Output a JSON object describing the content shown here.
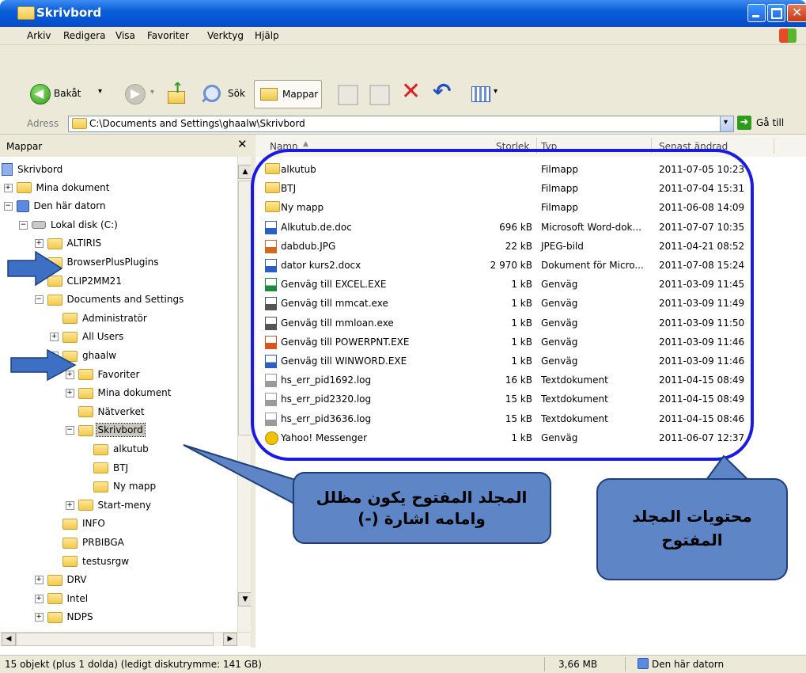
{
  "window": {
    "title": "Skrivbord"
  },
  "menu": [
    "Arkiv",
    "Redigera",
    "Visa",
    "Favoriter",
    "Verktyg",
    "Hjälp"
  ],
  "toolbar": {
    "back_label": "Bakåt",
    "search_label": "Sök",
    "folders_label": "Mappar"
  },
  "address": {
    "label": "Adress",
    "path": "C:\\Documents and Settings\\ghaalw\\Skrivbord",
    "go_label": "Gå till"
  },
  "tree": {
    "header": "Mappar",
    "nodes": [
      {
        "label": "Skrivbord",
        "indent": 0,
        "icon": "desktop-icon",
        "expander": ""
      },
      {
        "label": "Mina dokument",
        "indent": 1,
        "icon": "documents-icon",
        "expander": "+"
      },
      {
        "label": "Den här datorn",
        "indent": 1,
        "icon": "computer-icon",
        "expander": "-"
      },
      {
        "label": "Lokal disk (C:)",
        "indent": 2,
        "icon": "drive-icon",
        "expander": "-"
      },
      {
        "label": "ALTIRIS",
        "indent": 3,
        "icon": "folder-icon",
        "expander": "+"
      },
      {
        "label": "BrowserPlusPlugins",
        "indent": 3,
        "icon": "folder-icon",
        "expander": "+"
      },
      {
        "label": "CLIP2MM21",
        "indent": 3,
        "icon": "folder-icon",
        "expander": ""
      },
      {
        "label": "Documents and Settings",
        "indent": 3,
        "icon": "folder-icon",
        "expander": "-"
      },
      {
        "label": "Administratör",
        "indent": 4,
        "icon": "folder-icon",
        "expander": ""
      },
      {
        "label": "All Users",
        "indent": 4,
        "icon": "folder-icon",
        "expander": "+"
      },
      {
        "label": "ghaalw",
        "indent": 4,
        "icon": "folder-icon",
        "expander": "-"
      },
      {
        "label": "Favoriter",
        "indent": 5,
        "icon": "folder-icon",
        "expander": "+"
      },
      {
        "label": "Mina dokument",
        "indent": 5,
        "icon": "folder-icon",
        "expander": "+"
      },
      {
        "label": "Nätverket",
        "indent": 5,
        "icon": "folder-icon",
        "expander": ""
      },
      {
        "label": "Skrivbord",
        "indent": 5,
        "icon": "folder-icon",
        "expander": "-",
        "selected": true
      },
      {
        "label": "alkutub",
        "indent": 6,
        "icon": "folder-icon",
        "expander": ""
      },
      {
        "label": "BTJ",
        "indent": 6,
        "icon": "folder-icon",
        "expander": ""
      },
      {
        "label": "Ny mapp",
        "indent": 6,
        "icon": "folder-icon",
        "expander": ""
      },
      {
        "label": "Start-meny",
        "indent": 5,
        "icon": "folder-icon",
        "expander": "+"
      },
      {
        "label": "INFO",
        "indent": 4,
        "icon": "folder-icon",
        "expander": ""
      },
      {
        "label": "PRBIBGA",
        "indent": 4,
        "icon": "folder-icon",
        "expander": ""
      },
      {
        "label": "testusrgw",
        "indent": 4,
        "icon": "folder-icon",
        "expander": ""
      },
      {
        "label": "DRV",
        "indent": 3,
        "icon": "folder-icon",
        "expander": "+"
      },
      {
        "label": "Intel",
        "indent": 3,
        "icon": "folder-icon",
        "expander": "+"
      },
      {
        "label": "NDPS",
        "indent": 3,
        "icon": "folder-icon",
        "expander": "+"
      }
    ]
  },
  "list": {
    "columns": [
      "Namn",
      "Storlek",
      "Typ",
      "Senast ändrad"
    ],
    "rows": [
      {
        "name": "alkutub",
        "size": "",
        "type": "Filmapp",
        "modified": "2011-07-05 10:23",
        "icon": "folder-icon"
      },
      {
        "name": "BTJ",
        "size": "",
        "type": "Filmapp",
        "modified": "2011-07-04 15:31",
        "icon": "folder-icon"
      },
      {
        "name": "Ny mapp",
        "size": "",
        "type": "Filmapp",
        "modified": "2011-06-08 14:09",
        "icon": "folder-icon"
      },
      {
        "name": "Alkutub.de.doc",
        "size": "696 kB",
        "type": "Microsoft Word-dok...",
        "modified": "2011-07-07 10:35",
        "icon": "word-doc-icon"
      },
      {
        "name": "dabdub.JPG",
        "size": "22 kB",
        "type": "JPEG-bild",
        "modified": "2011-04-21 08:52",
        "icon": "image-icon"
      },
      {
        "name": "dator kurs2.docx",
        "size": "2 970 kB",
        "type": "Dokument för Micro...",
        "modified": "2011-07-08 15:24",
        "icon": "word-doc-icon"
      },
      {
        "name": "Genväg till EXCEL.EXE",
        "size": "1 kB",
        "type": "Genväg",
        "modified": "2011-03-09 11:45",
        "icon": "excel-icon"
      },
      {
        "name": "Genväg till mmcat.exe",
        "size": "1 kB",
        "type": "Genväg",
        "modified": "2011-03-09 11:49",
        "icon": "exe-icon"
      },
      {
        "name": "Genväg till mmloan.exe",
        "size": "1 kB",
        "type": "Genväg",
        "modified": "2011-03-09 11:50",
        "icon": "exe-icon"
      },
      {
        "name": "Genväg till POWERPNT.EXE",
        "size": "1 kB",
        "type": "Genväg",
        "modified": "2011-03-09 11:46",
        "icon": "powerpoint-icon"
      },
      {
        "name": "Genväg till WINWORD.EXE",
        "size": "1 kB",
        "type": "Genväg",
        "modified": "2011-03-09 11:46",
        "icon": "word-icon"
      },
      {
        "name": "hs_err_pid1692.log",
        "size": "16 kB",
        "type": "Textdokument",
        "modified": "2011-04-15 08:49",
        "icon": "text-file-icon"
      },
      {
        "name": "hs_err_pid2320.log",
        "size": "15 kB",
        "type": "Textdokument",
        "modified": "2011-04-15 08:49",
        "icon": "text-file-icon"
      },
      {
        "name": "hs_err_pid3636.log",
        "size": "15 kB",
        "type": "Textdokument",
        "modified": "2011-04-15 08:46",
        "icon": "text-file-icon"
      },
      {
        "name": "Yahoo! Messenger",
        "size": "1 kB",
        "type": "Genväg",
        "modified": "2011-06-07 12:37",
        "icon": "yahoo-messenger-icon"
      }
    ]
  },
  "status": {
    "objects": "15 objekt (plus 1 dolda) (ledigt diskutrymme: 141 GB)",
    "size": "3,66 MB",
    "location": "Den här datorn"
  },
  "annotations": {
    "callout_open_folder": "المجلد المفتوح يكون مظلل وامامه اشارة (-)",
    "callout_contents": "محتويات المجلد المفتوح"
  },
  "colors": {
    "titlebar": "#0553d2",
    "selection": "#316ac5",
    "highlight_ring": "#1a1ae6",
    "callout_fill": "#5e86c6",
    "arrow": "#3d6fc4"
  }
}
